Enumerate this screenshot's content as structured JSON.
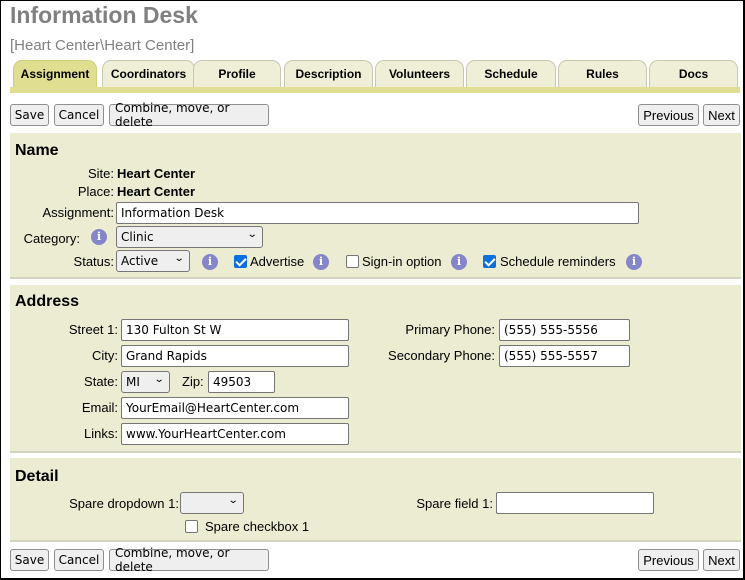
{
  "header": {
    "title": "Information Desk",
    "subtitle": "[Heart Center\\Heart Center]"
  },
  "tabs": [
    {
      "label": "Assignment",
      "active": true
    },
    {
      "label": "Coordinators",
      "active": false
    },
    {
      "label": "Profile",
      "active": false
    },
    {
      "label": "Description",
      "active": false
    },
    {
      "label": "Volunteers",
      "active": false
    },
    {
      "label": "Schedule",
      "active": false
    },
    {
      "label": "Rules",
      "active": false
    },
    {
      "label": "Docs",
      "active": false
    }
  ],
  "toolbar": {
    "save_label": "Save",
    "cancel_label": "Cancel",
    "combine_label": "Combine, move, or delete",
    "previous_label": "Previous",
    "next_label": "Next"
  },
  "name_section": {
    "title": "Name",
    "site_label": "Site:",
    "site_value": "Heart Center",
    "place_label": "Place:",
    "place_value": "Heart Center",
    "assignment_label": "Assignment:",
    "assignment_value": "Information Desk",
    "category_label": "Category:",
    "category_value": "Clinic",
    "status_label": "Status:",
    "status_value": "Active",
    "advertise_label": "Advertise",
    "advertise_checked": true,
    "signin_label": "Sign-in option",
    "signin_checked": false,
    "reminders_label": "Schedule reminders",
    "reminders_checked": true,
    "info_glyph": "i"
  },
  "address_section": {
    "title": "Address",
    "street1_label": "Street 1:",
    "street1_value": "130 Fulton St W",
    "city_label": "City:",
    "city_value": "Grand Rapids",
    "state_label": "State:",
    "state_value": "MI",
    "zip_label": "Zip:",
    "zip_value": "49503",
    "email_label": "Email:",
    "email_value": "YourEmail@HeartCenter.com",
    "links_label": "Links:",
    "links_value": "www.YourHeartCenter.com",
    "primary_phone_label": "Primary Phone:",
    "primary_phone_value": "(555) 555-5556",
    "secondary_phone_label": "Secondary Phone:",
    "secondary_phone_value": "(555) 555-5557"
  },
  "detail_section": {
    "title": "Detail",
    "spare_dropdown_label": "Spare dropdown 1:",
    "spare_dropdown_value": "",
    "spare_checkbox_label": "Spare checkbox 1",
    "spare_checkbox_checked": false,
    "spare_field_label": "Spare field 1:",
    "spare_field_value": ""
  },
  "icons": {
    "chevron": "⌄"
  }
}
